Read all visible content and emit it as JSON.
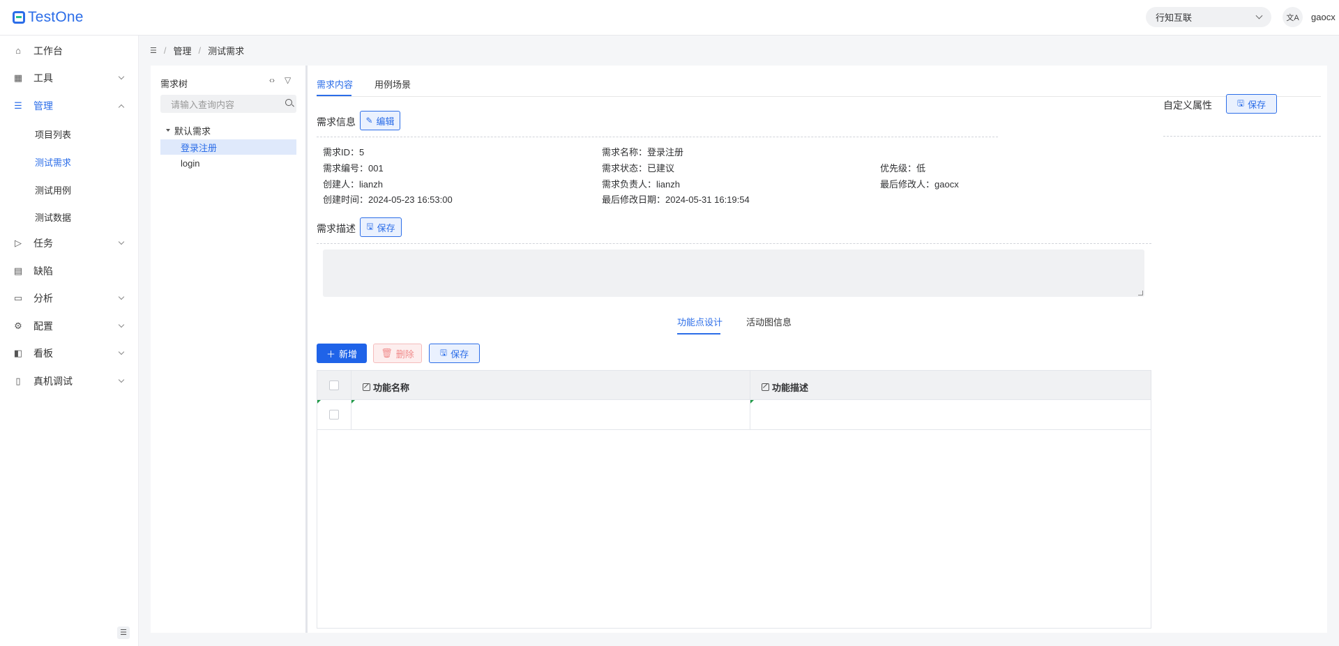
{
  "app": {
    "name": "TestOne"
  },
  "header": {
    "org": "行知互联",
    "lang_icon": "translate-icon",
    "user": "gaocx"
  },
  "sidebar": {
    "items": [
      {
        "label": "工作台",
        "icon": "home-icon"
      },
      {
        "label": "工具",
        "icon": "grid-icon"
      },
      {
        "label": "管理",
        "icon": "list-icon"
      },
      {
        "label": "任务",
        "icon": "send-icon"
      },
      {
        "label": "缺陷",
        "icon": "file-icon"
      },
      {
        "label": "分析",
        "icon": "calendar-icon"
      },
      {
        "label": "配置",
        "icon": "gear-icon"
      },
      {
        "label": "看板",
        "icon": "board-icon"
      },
      {
        "label": "真机调试",
        "icon": "device-icon"
      }
    ],
    "sub_items": [
      "项目列表",
      "测试需求",
      "测试用例",
      "测试数据"
    ]
  },
  "breadcrumb": {
    "level1": "管理",
    "level2": "测试需求"
  },
  "tree": {
    "title": "需求树",
    "search_placeholder": "请输入查询内容",
    "root": "默认需求",
    "children": [
      "登录注册",
      "login"
    ]
  },
  "tabs": [
    "需求内容",
    "用例场景"
  ],
  "info": {
    "title": "需求信息",
    "edit_label": "编辑",
    "id": "需求ID：5",
    "name": "需求名称：登录注册",
    "number": "需求编号：001",
    "status": "需求状态：已建议",
    "priority": "优先级：低",
    "creator": "创建人：lianzh",
    "owner": "需求负责人：lianzh",
    "modifier": "最后修改人：gaocx",
    "created_at": "创建时间：2024-05-23 16:53:00",
    "modified_at": "最后修改日期：2024-05-31 16:19:54"
  },
  "description": {
    "title": "需求描述",
    "save_label": "保存",
    "value": ""
  },
  "custom": {
    "title": "自定义属性",
    "save_label": "保存"
  },
  "subtabs": [
    "功能点设计",
    "活动图信息"
  ],
  "toolbar": {
    "add_label": "新增",
    "delete_label": "删除",
    "save_label": "保存"
  },
  "grid": {
    "columns": [
      "功能名称",
      "功能描述"
    ]
  }
}
